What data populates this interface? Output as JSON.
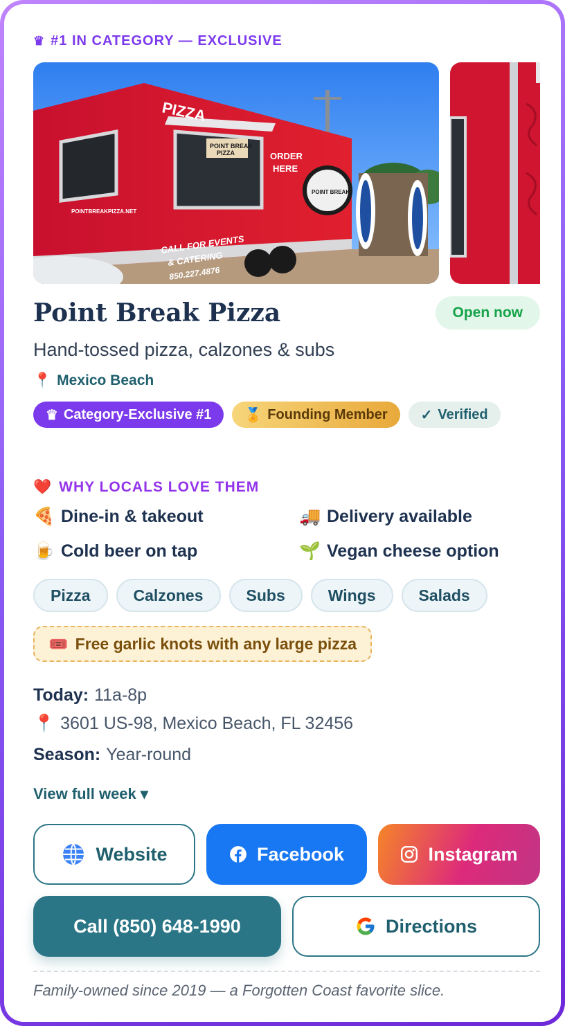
{
  "card": {
    "eyebrow": "#1 IN CATEGORY — EXCLUSIVE",
    "eyebrow_icon": "crown-icon"
  },
  "photos": {
    "main_alt": "Point Break Pizza food truck",
    "main_text": {
      "side_sign": "PIZZA",
      "window_sign_1": "POINT BREAK",
      "window_sign_2": "PIZZA",
      "order_here_1": "ORDER",
      "order_here_2": "HERE",
      "logo": "POINT BREAK",
      "website": "POINTBREAKPIZZA.NET",
      "catering_1": "CALL FOR EVENTS",
      "catering_2": "& CATERING",
      "phone": "850.227.4876"
    }
  },
  "business": {
    "name": "Point Break Pizza",
    "status": "Open now",
    "tagline": "Hand-tossed pizza, calzones & subs",
    "location": "Mexico Beach",
    "location_icon": "pin-icon"
  },
  "badges": [
    {
      "label": "Category-Exclusive #1",
      "icon": "♛"
    },
    {
      "label": "Founding Member",
      "icon": "🏅"
    },
    {
      "label": "Verified",
      "icon": "✓"
    }
  ],
  "why": {
    "heading": "WHY LOCALS LOVE THEM",
    "icon": "❤️",
    "features": [
      {
        "emoji": "🍕",
        "label": "Dine-in & takeout"
      },
      {
        "emoji": "🚚",
        "label": "Delivery available"
      },
      {
        "emoji": "🍺",
        "label": "Cold beer on tap"
      },
      {
        "emoji": "🌱",
        "label": "Vegan cheese option"
      }
    ]
  },
  "chips": [
    "Pizza",
    "Calzones",
    "Subs",
    "Wings",
    "Salads"
  ],
  "deal": {
    "icon": "🎟️",
    "text": "Free garlic knots with any large pizza"
  },
  "info": {
    "today_label": "Today:",
    "today_value": "11a-8p",
    "address": "3601 US-98, Mexico Beach, FL 32456",
    "season_label": "Season:",
    "season_value": "Year-round",
    "view_week": "View full week ▾"
  },
  "actions": {
    "website": "Website",
    "facebook": "Facebook",
    "instagram": "Instagram",
    "call": "Call (850) 648-1990",
    "directions": "Directions"
  },
  "footer": "Family-owned since 2019 — a Forgotten Coast favorite slice.",
  "colors": {
    "frame": "#8b5cf6",
    "accent_purple": "#7c3aed",
    "teal": "#2b7686",
    "open_green": "#16a34a",
    "facebook_blue": "#1877f2"
  }
}
